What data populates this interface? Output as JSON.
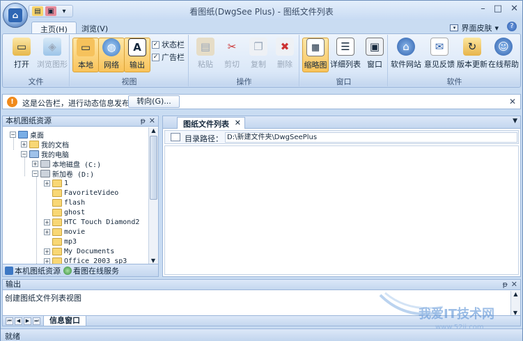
{
  "title": "看图纸(DwgSee Plus) - 图纸文件列表",
  "tabs": [
    {
      "label": "主页(H)"
    },
    {
      "label": "浏览(V)"
    }
  ],
  "skin_label": "界面皮肤",
  "ribbon": {
    "groups": [
      {
        "label": "文件",
        "buttons": [
          "打开",
          "浏览图形"
        ]
      },
      {
        "label": "视图",
        "buttons": [
          "本地",
          "网络",
          "输出"
        ],
        "checks": [
          "状态栏",
          "广告栏"
        ]
      },
      {
        "label": "操作",
        "buttons": [
          "粘贴",
          "剪切",
          "复制",
          "删除"
        ]
      },
      {
        "label": "窗口",
        "buttons": [
          "缩略图",
          "详细列表",
          "窗口"
        ]
      },
      {
        "label": "软件",
        "buttons": [
          "软件网站",
          "意见反馈",
          "版本更新",
          "在线帮助"
        ]
      }
    ]
  },
  "notice": {
    "text": "这是公告栏，进行动态信息发布",
    "goto": "转向(G)..."
  },
  "left_pane": {
    "title": "本机图纸资源",
    "tree": [
      "桌面",
      "我的文档",
      "我的电脑",
      "本地磁盘 (C:)",
      "新加卷 (D:)",
      "1",
      "FavoriteVideo",
      "flash",
      "ghost",
      "HTC Touch Diamond2",
      "movie",
      "mp3",
      "My Documents",
      "Office 2003 sp3"
    ],
    "tabs": [
      "本机图纸资源",
      "看图在线服务"
    ]
  },
  "right_pane": {
    "tab": "图纸文件列表",
    "path_label": "目录路径：",
    "path_value": "D:\\新建文件夹\\DwgSeePlus"
  },
  "output": {
    "title": "输出",
    "text": "创建图纸文件列表视图",
    "tab": "信息窗口"
  },
  "status": "就绪",
  "watermark": {
    "text1": "我爱IT技术网",
    "text2": "www.52ij.com"
  },
  "colors": {
    "accent": "#f9c35a",
    "ribbon": "#dbe8f8",
    "frame": "#c9dcf2"
  }
}
